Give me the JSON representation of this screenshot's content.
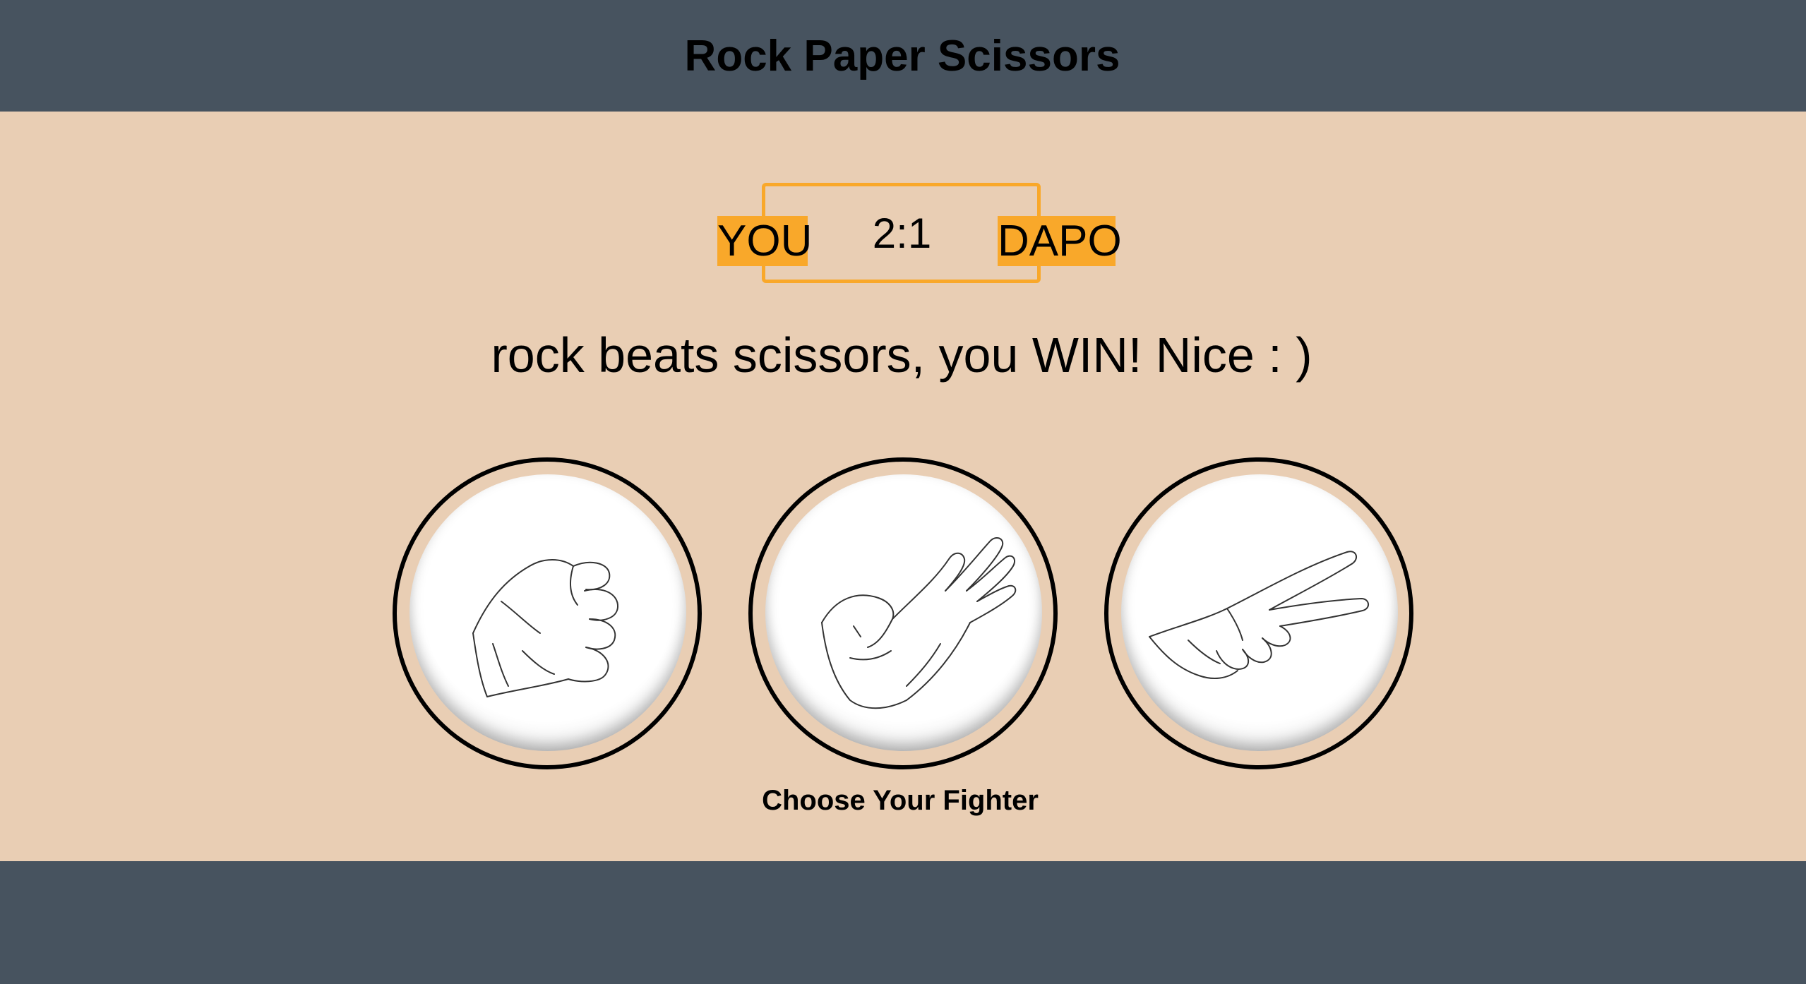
{
  "header": {
    "title": "Rock Paper Scissors"
  },
  "scoreboard": {
    "player_label": "YOU",
    "score": "2:1",
    "opponent_label": "DAPO"
  },
  "result": {
    "message": "rock beats scissors, you WIN! Nice : )"
  },
  "choices": [
    {
      "name": "rock",
      "icon": "rock-hand-icon"
    },
    {
      "name": "paper",
      "icon": "paper-hand-icon"
    },
    {
      "name": "scissors",
      "icon": "scissors-hand-icon"
    }
  ],
  "prompt": {
    "text": "Choose Your Fighter"
  },
  "colors": {
    "background": "#e9ceb4",
    "bars": "#47535f",
    "accent": "#f9a82a"
  }
}
